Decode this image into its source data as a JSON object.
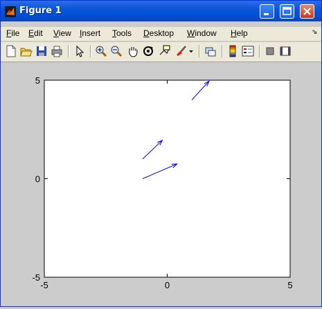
{
  "window": {
    "title": "Figure 1"
  },
  "menu": {
    "items": [
      "File",
      "Edit",
      "View",
      "Insert",
      "Tools",
      "Desktop",
      "Window",
      "Help"
    ],
    "mnemonics": [
      "F",
      "E",
      "V",
      "I",
      "T",
      "D",
      "W",
      "H"
    ]
  },
  "toolbar": {
    "icons": [
      "new-figure-icon",
      "open-icon",
      "save-icon",
      "print-icon",
      "edit-plot-icon",
      "zoom-in-icon",
      "zoom-out-icon",
      "pan-icon",
      "rotate-3d-icon",
      "data-cursor-icon",
      "brush-icon",
      "brush-dropdown-icon",
      "link-plot-icon",
      "colorbar-icon",
      "legend-icon",
      "hide-plot-tools-icon",
      "show-plot-tools-icon"
    ]
  },
  "chart_data": {
    "type": "quiver",
    "title": "",
    "xlabel": "",
    "ylabel": "",
    "xlim": [
      -5,
      5
    ],
    "ylim": [
      -5,
      5
    ],
    "xticks": [
      -5,
      0,
      5
    ],
    "yticks": [
      -5,
      0,
      5
    ],
    "xtick_labels": [
      "-5",
      "0",
      "5"
    ],
    "ytick_labels": [
      "-5",
      "0",
      "5"
    ],
    "grid": false,
    "arrows": [
      {
        "x": -1.0,
        "y": 0.0,
        "u": 1.4,
        "v": 0.75
      },
      {
        "x": -1.0,
        "y": 1.0,
        "u": 0.8,
        "v": 0.95
      },
      {
        "x": 1.0,
        "y": 4.0,
        "u": 0.7,
        "v": 0.95
      }
    ],
    "color": "#0000ff"
  }
}
